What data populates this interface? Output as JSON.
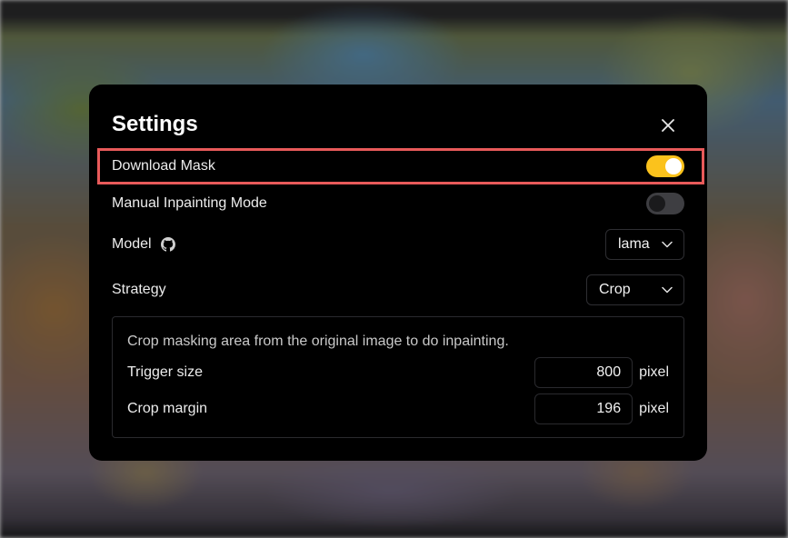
{
  "colors": {
    "accent": "#fbc21c",
    "highlight_border": "#e85a5a",
    "dialog_bg": "#000000"
  },
  "dialog": {
    "title": "Settings",
    "close_icon": "close-icon"
  },
  "settings": {
    "download_mask": {
      "label": "Download Mask",
      "enabled": true
    },
    "manual_inpainting": {
      "label": "Manual Inpainting Mode",
      "enabled": false
    },
    "model": {
      "label": "Model",
      "icon": "github-icon",
      "value": "lama"
    },
    "strategy": {
      "label": "Strategy",
      "value": "Crop"
    }
  },
  "crop_panel": {
    "description": "Crop masking area from the original image to do inpainting.",
    "trigger_size": {
      "label": "Trigger size",
      "value": "800",
      "unit": "pixel"
    },
    "crop_margin": {
      "label": "Crop margin",
      "value": "196",
      "unit": "pixel"
    }
  }
}
